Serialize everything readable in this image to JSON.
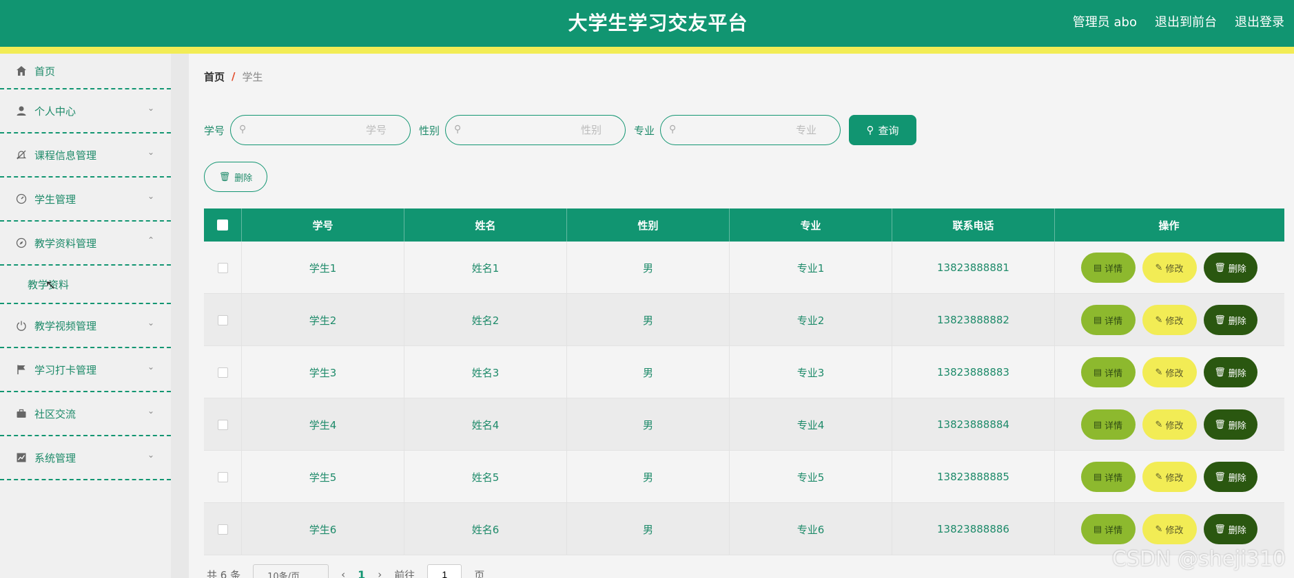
{
  "header": {
    "title": "大学生学习交友平台",
    "user": "管理员 abo",
    "to_front": "退出到前台",
    "logout": "退出登录"
  },
  "sidebar": {
    "items": [
      {
        "label": "首页",
        "icon": "home-icon"
      },
      {
        "label": "个人中心",
        "icon": "user-icon"
      },
      {
        "label": "课程信息管理",
        "icon": "bell-off-icon"
      },
      {
        "label": "学生管理",
        "icon": "gauge-icon"
      },
      {
        "label": "教学资料管理",
        "icon": "compass-icon"
      },
      {
        "label": "教学视频管理",
        "icon": "power-icon"
      },
      {
        "label": "学习打卡管理",
        "icon": "flag-icon"
      },
      {
        "label": "社区交流",
        "icon": "briefcase-icon"
      },
      {
        "label": "系统管理",
        "icon": "chart-icon"
      }
    ],
    "submenu": {
      "label": "教学资料"
    }
  },
  "breadcrumb": {
    "home": "首页",
    "sep": "/",
    "current": "学生"
  },
  "search": {
    "label_id": "学号",
    "placeholder_id": "学号",
    "label_gender": "性别",
    "placeholder_gender": "性别",
    "label_major": "专业",
    "placeholder_major": "专业",
    "query": "查询"
  },
  "actions": {
    "delete": "删除"
  },
  "table": {
    "headers": [
      "学号",
      "姓名",
      "性别",
      "专业",
      "联系电话",
      "操作"
    ],
    "rows": [
      {
        "id": "学生1",
        "name": "姓名1",
        "gender": "男",
        "major": "专业1",
        "phone": "13823888881"
      },
      {
        "id": "学生2",
        "name": "姓名2",
        "gender": "男",
        "major": "专业2",
        "phone": "13823888882"
      },
      {
        "id": "学生3",
        "name": "姓名3",
        "gender": "男",
        "major": "专业3",
        "phone": "13823888883"
      },
      {
        "id": "学生4",
        "name": "姓名4",
        "gender": "男",
        "major": "专业4",
        "phone": "13823888884"
      },
      {
        "id": "学生5",
        "name": "姓名5",
        "gender": "男",
        "major": "专业5",
        "phone": "13823888885"
      },
      {
        "id": "学生6",
        "name": "姓名6",
        "gender": "男",
        "major": "专业6",
        "phone": "13823888886"
      }
    ],
    "op_detail": "详情",
    "op_edit": "修改",
    "op_delete": "删除"
  },
  "pagination": {
    "total": "共 6 条",
    "page_size": "10条/页",
    "current": "1",
    "goto_prefix": "前往",
    "goto_value": "1",
    "goto_suffix": "页"
  },
  "watermark": "CSDN @sheji310",
  "colors": {
    "primary": "#119571",
    "accent": "#f2ec55",
    "detail": "#8db92e",
    "delete": "#2a5710"
  }
}
